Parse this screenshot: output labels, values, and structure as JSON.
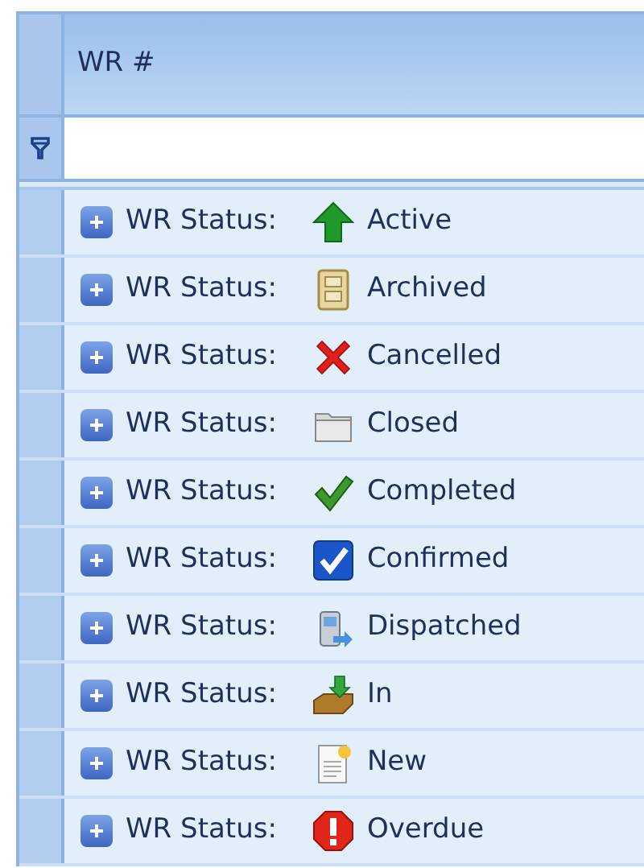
{
  "grid": {
    "columns": [
      {
        "label": "WR #"
      }
    ],
    "groups": [
      {
        "label": "WR Status:",
        "value": "Active",
        "kind": "active",
        "expanded": false
      },
      {
        "label": "WR Status:",
        "value": "Archived",
        "kind": "archived",
        "expanded": false
      },
      {
        "label": "WR Status:",
        "value": "Cancelled",
        "kind": "cancelled",
        "expanded": false
      },
      {
        "label": "WR Status:",
        "value": "Closed",
        "kind": "closed",
        "expanded": false
      },
      {
        "label": "WR Status:",
        "value": "Completed",
        "kind": "completed",
        "expanded": false
      },
      {
        "label": "WR Status:",
        "value": "Confirmed",
        "kind": "confirmed",
        "expanded": false
      },
      {
        "label": "WR Status:",
        "value": "Dispatched",
        "kind": "dispatched",
        "expanded": false
      },
      {
        "label": "WR Status:",
        "value": "In",
        "kind": "in",
        "expanded": false
      },
      {
        "label": "WR Status:",
        "value": "New",
        "kind": "new",
        "expanded": false
      },
      {
        "label": "WR Status:",
        "value": "Overdue",
        "kind": "overdue",
        "expanded": false
      }
    ]
  }
}
